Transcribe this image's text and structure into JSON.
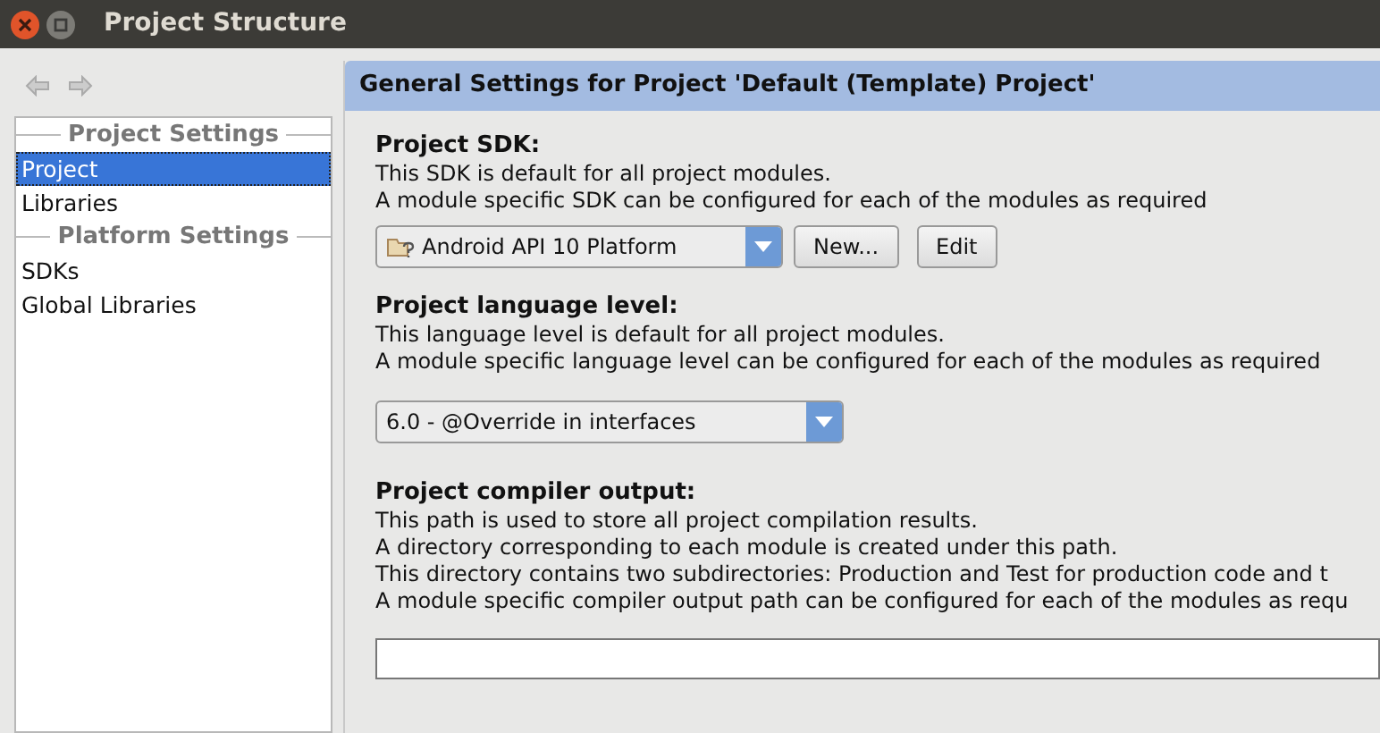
{
  "window": {
    "title": "Project Structure"
  },
  "sidebar": {
    "groups": [
      {
        "header": "Project Settings",
        "items": [
          {
            "label": "Project",
            "selected": true
          },
          {
            "label": "Libraries",
            "selected": false
          }
        ]
      },
      {
        "header": "Platform Settings",
        "items": [
          {
            "label": "SDKs",
            "selected": false
          },
          {
            "label": "Global Libraries",
            "selected": false
          }
        ]
      }
    ]
  },
  "panel": {
    "title": "General Settings for Project 'Default (Template) Project'",
    "sections": [
      {
        "kind": "sdk",
        "heading": "Project SDK:",
        "lines": [
          "This SDK is default for all project modules.",
          "A module specific SDK can be configured for each of the modules as required"
        ],
        "value": "Android API 10 Platform",
        "buttons": [
          "New...",
          "Edit"
        ]
      },
      {
        "kind": "level",
        "heading": "Project language level:",
        "lines": [
          "This language level is default for all project modules.",
          "A module specific language level can be configured for each of the modules as required"
        ],
        "value": "6.0 - @Override in interfaces"
      },
      {
        "kind": "path",
        "heading": "Project compiler output:",
        "lines": [
          "This path is used to store all project compilation results.",
          "A directory corresponding to each module is created under this path.",
          "This directory contains two subdirectories: Production and Test for production code and t",
          "A module specific compiler output path can be configured for each of the modules as requ"
        ]
      }
    ]
  }
}
